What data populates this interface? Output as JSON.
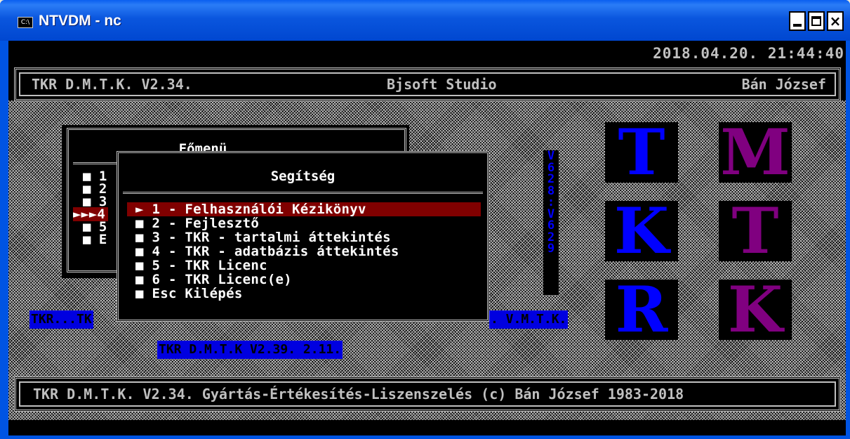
{
  "window": {
    "title": "NTVDM - nc",
    "icon": "console-icon",
    "icon_text": "C:\\",
    "minimize_label": "minimize",
    "maximize_label": "maximize",
    "close_label": "×"
  },
  "clock": "2018.04.20. 21:44:40",
  "header": {
    "left": "TKR D.M.T.K. V2.34.",
    "center": "Bjsoft Studio",
    "right": "Bán József"
  },
  "main_menu": {
    "title": "Főmenü",
    "items": [
      "■ 1",
      "■ 2",
      "■ 3",
      "►►►4",
      "■ 5",
      "■ E"
    ]
  },
  "help_menu": {
    "title": "Segítség",
    "items": [
      "► 1 - Felhasználói Kézikönyv",
      "■ 2 - Fejlesztő",
      "■ 3 - TKR - tartalmi áttekintés",
      "■ 4 - TKR - adatbázis áttekintés",
      "■ 5 - TKR Licenc",
      "■ 6 - TKR Licenc(e)",
      "■ Esc Kilépés"
    ],
    "selected_index": 0
  },
  "marquee_left": "TKR...TK",
  "marquee_right": ". V.M.T.K.",
  "version_strip": "TKR D.M.T.K V2.39. 2.11.",
  "vertical_strip": [
    "V",
    "6",
    "2",
    "8",
    ":",
    "V",
    "6",
    "2",
    "9"
  ],
  "logo": {
    "letters": [
      "T",
      "M",
      "K",
      "T",
      "R",
      "K"
    ],
    "colors": [
      "#0000ff",
      "#800080",
      "#0000ff",
      "#800080",
      "#0000ff",
      "#800080"
    ]
  },
  "footer": "TKR D.M.T.K. V2.34. Gyártás-Értékesítés-Liszenszelés (c) Bán József 1983-2018",
  "colors": {
    "selection": "#800000",
    "accent_blue": "#0000e0",
    "accent_purple": "#800080",
    "text": "#c0c0c0"
  }
}
